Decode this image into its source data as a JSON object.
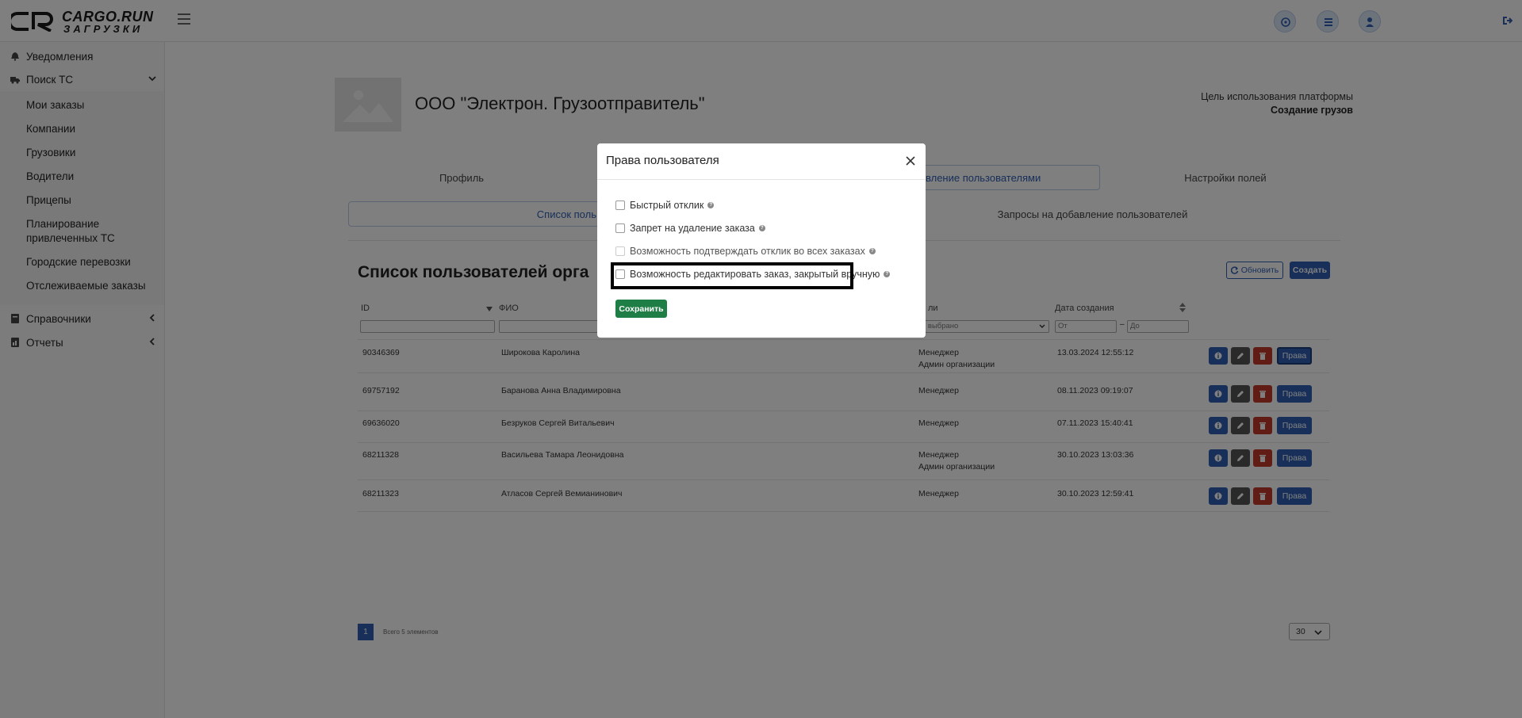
{
  "logo": {
    "line1": "CARGO.RUN",
    "line2": "ЗАГРУЗКИ"
  },
  "sidebar": {
    "notifications": "Уведомления",
    "search": "Поиск ТС",
    "sub": [
      "Мои заказы",
      "Компании",
      "Грузовики",
      "Водители",
      "Прицепы",
      "Планирование",
      "привлеченных ТС",
      "Городские перевозки",
      "Отслеживаемые заказы"
    ],
    "references": "Справочники",
    "reports": "Отчеты"
  },
  "company": {
    "name": "ООО \"Электрон. Грузоотправитель\"",
    "goal_label": "Цель использования платформы",
    "goal_value": "Создание грузов"
  },
  "tabs": {
    "profile": "Профиль",
    "users": "вление пользователями",
    "fields": "Настройки полей"
  },
  "subtabs": {
    "list": "Список поль",
    "requests": "Запросы на добавление пользователей"
  },
  "list": {
    "title": "Список пользователей орга",
    "refresh": "Обновить",
    "create": "Создать",
    "col_id": "ID",
    "col_fio": "ФИО",
    "col_role": "ли",
    "col_date": "Дата создания",
    "filter_role": "е выбрано",
    "filter_from": "От",
    "filter_to": "До",
    "date_dash": "–",
    "rights_label": "Права"
  },
  "rows": [
    {
      "id": "90346369",
      "fio": "Широкова Каролина",
      "role1": "Менеджер",
      "role2": "Админ организации",
      "date": "13.03.2024 12:55:12"
    },
    {
      "id": "69757192",
      "fio": "Баранова Анна Владимировна",
      "role1": "Менеджер",
      "role2": "",
      "date": "08.11.2023 09:19:07"
    },
    {
      "id": "69636020",
      "fio": "Безруков Сергей Витальевич",
      "role1": "Менеджер",
      "role2": "",
      "date": "07.11.2023 15:40:41"
    },
    {
      "id": "68211328",
      "fio": "Васильева Тамара Леонидовна",
      "role1": "Менеджер",
      "role2": "Админ организации",
      "date": "30.10.2023 13:03:36"
    },
    {
      "id": "68211323",
      "fio": "Атласов Сергей Вемианинович",
      "role1": "Менеджер",
      "role2": "",
      "date": "30.10.2023 12:59:41"
    }
  ],
  "pager": {
    "page": "1",
    "info": "Всего 5 элементов",
    "per_page": "30"
  },
  "modal": {
    "title": "Права пользователя",
    "opt1": "Быстрый отклик",
    "opt2": "Запрет на удаление заказа",
    "opt3": "Возможность подтверждать отклик во всех заказах",
    "opt4": "Возможность редактировать заказ, закрытый вручную",
    "save": "Сохранить",
    "help_glyph": "?"
  },
  "colors": {
    "primary": "#2f5fb3",
    "success": "#1e7e45",
    "danger": "#c0392b",
    "dark": "#555555"
  }
}
